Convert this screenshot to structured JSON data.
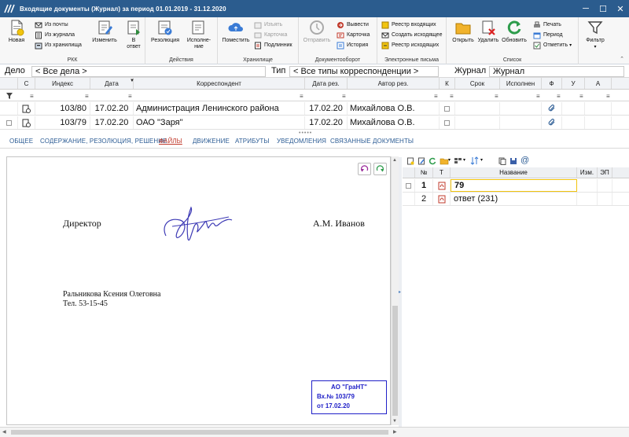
{
  "window": {
    "title": "Входящие документы (Журнал) за период 01.01.2019 - 31.12.2020",
    "min_icon": "minimize-icon",
    "max_icon": "maximize-icon",
    "close_icon": "close-icon"
  },
  "ribbon": {
    "rkk": {
      "label": "РКК",
      "new": "Новая",
      "from_mail": "Из почты",
      "from_journal": "Из журнала",
      "from_storage": "Из хранилища",
      "edit": "Изменить",
      "in_answer": "В ответ"
    },
    "actions": {
      "label": "Действия",
      "resolution": "Резолюция",
      "execution": "Исполне-ние"
    },
    "storage": {
      "label": "Хранилище",
      "place": "Поместить",
      "extract": "Изъять",
      "card": "Карточка",
      "original": "Подлинник"
    },
    "docflow": {
      "label": "Документооборот",
      "send": "Отправить",
      "output": "Вывести",
      "card": "Карточка",
      "history": "История"
    },
    "email": {
      "label": "Электронные письма",
      "registry_in": "Реестр входящих",
      "create_out": "Создать исходящее",
      "registry_out": "Реестр исходящих"
    },
    "list": {
      "label": "Список",
      "open": "Открыть",
      "delete": "Удалить",
      "refresh": "Обновить",
      "print": "Печать",
      "period": "Период",
      "mark": "Отметить"
    },
    "filter": "Фильтр"
  },
  "filters": {
    "delo_label": "Дело",
    "delo_value": "< Все дела >",
    "type_label": "Тип",
    "type_value": "< Все типы корреспонденции >",
    "journal_label": "Журнал",
    "journal_value": "Журнал"
  },
  "table": {
    "columns": [
      "С",
      "Индекс",
      "Дата",
      "Корреспондент",
      "Дата рез.",
      "Автор рез.",
      "К",
      "Срок",
      "Исполнен",
      "Ф",
      "У",
      "А"
    ],
    "rows": [
      {
        "index": "103/80",
        "date": "17.02.20",
        "correspondent": "Администрация Ленинского района",
        "res_date": "17.02.20",
        "author": "Михайлова О.В."
      },
      {
        "index": "103/79",
        "date": "17.02.20",
        "correspondent": "ОАО \"Заря\"",
        "res_date": "17.02.20",
        "author": "Михайлова О.В."
      }
    ]
  },
  "tabs": [
    "ОБЩЕЕ",
    "СОДЕРЖАНИЕ, РЕЗОЛЮЦИЯ, РЕШЕНИЕ",
    "ФАЙЛЫ",
    "ДВИЖЕНИЕ",
    "АТРИБУТЫ",
    "УВЕДОМЛЕНИЯ",
    "СВЯЗАННЫЕ ДОКУМЕНТЫ"
  ],
  "document": {
    "position": "Директор",
    "signer": "А.М. Иванов",
    "executor": "Ральникова Ксения Олеговна",
    "phone": "Тел. 53-15-45",
    "stamp_org": "АО \"ГраНТ\"",
    "stamp_number": "Вх.№ 103/79",
    "stamp_date": "от 17.02.20"
  },
  "files": {
    "columns": [
      "№",
      "Т",
      "Название",
      "Изм.",
      "ЭП"
    ],
    "rows": [
      {
        "num": "1",
        "name": "79"
      },
      {
        "num": "2",
        "name": "ответ (231)"
      }
    ]
  },
  "colors": {
    "titlebar": "#2b5c8e",
    "tab_link": "#2d5d95",
    "tab_active": "#c0392b",
    "stamp": "#2020c8"
  }
}
